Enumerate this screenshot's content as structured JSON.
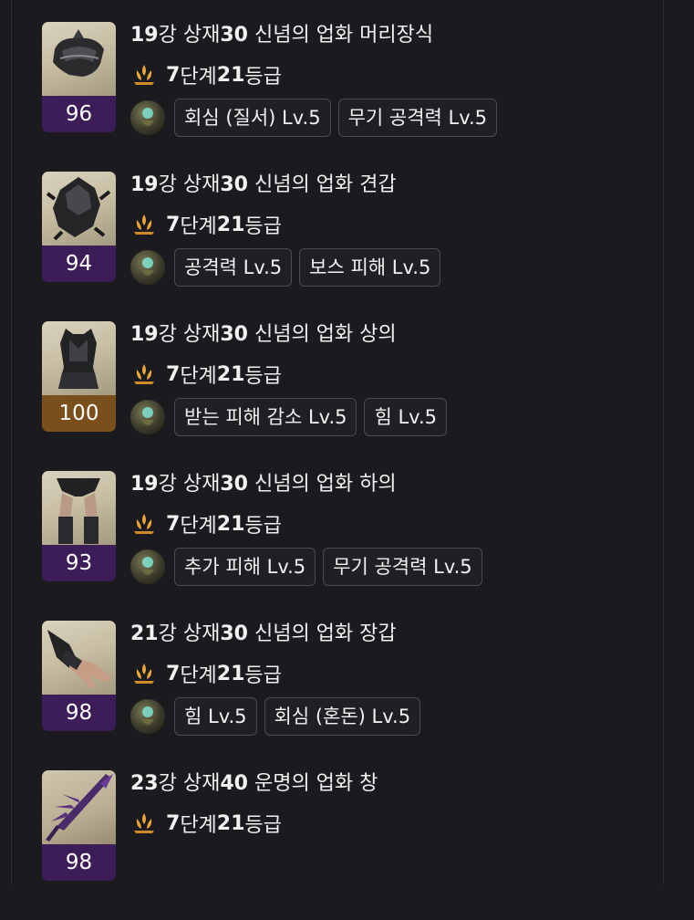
{
  "items": [
    {
      "level": "96",
      "title_num1": "19",
      "title_txt1": "강 상재",
      "title_num2": "30",
      "title_txt2": " 신념의 업화 머리장식",
      "tier_num1": "7",
      "tier_txt1": "단계 ",
      "tier_num2": "21",
      "tier_txt2": "등급",
      "engravings": [
        "회심 (질서) Lv.5",
        "무기 공격력 Lv.5"
      ]
    },
    {
      "level": "94",
      "title_num1": "19",
      "title_txt1": "강 상재",
      "title_num2": "30",
      "title_txt2": " 신념의 업화 견갑",
      "tier_num1": "7",
      "tier_txt1": "단계 ",
      "tier_num2": "21",
      "tier_txt2": "등급",
      "engravings": [
        "공격력 Lv.5",
        "보스 피해 Lv.5"
      ]
    },
    {
      "level": "100",
      "title_num1": "19",
      "title_txt1": "강 상재",
      "title_num2": "30",
      "title_txt2": " 신념의 업화 상의",
      "tier_num1": "7",
      "tier_txt1": "단계 ",
      "tier_num2": "21",
      "tier_txt2": "등급",
      "engravings": [
        "받는 피해 감소 Lv.5",
        "힘 Lv.5"
      ]
    },
    {
      "level": "93",
      "title_num1": "19",
      "title_txt1": "강 상재",
      "title_num2": "30",
      "title_txt2": " 신념의 업화 하의",
      "tier_num1": "7",
      "tier_txt1": "단계 ",
      "tier_num2": "21",
      "tier_txt2": "등급",
      "engravings": [
        "추가 피해 Lv.5",
        "무기 공격력 Lv.5"
      ]
    },
    {
      "level": "98",
      "title_num1": "21",
      "title_txt1": "강 상재",
      "title_num2": "30",
      "title_txt2": " 신념의 업화 장갑",
      "tier_num1": "7",
      "tier_txt1": "단계 ",
      "tier_num2": "21",
      "tier_txt2": "등급",
      "engravings": [
        "힘 Lv.5",
        "회심 (혼돈) Lv.5"
      ]
    },
    {
      "level": "98",
      "title_num1": "23",
      "title_txt1": "강 상재",
      "title_num2": "40",
      "title_txt2": " 운명의 업화 창",
      "tier_num1": "7",
      "tier_txt1": "단계 ",
      "tier_num2": "21",
      "tier_txt2": "등급",
      "engravings": []
    }
  ],
  "colors": {
    "background": "#1b1b1f",
    "level_purple": "#3d1d58",
    "level_gold": "#7a4f1c",
    "flame": "#e8a53a"
  },
  "icons": {
    "tier": "flame-icon",
    "engraving": "elixir-orb-icon",
    "head": "helmet-icon",
    "shoulder": "pauldron-icon",
    "chest": "chest-armor-icon",
    "legs": "leg-armor-icon",
    "gloves": "glove-icon",
    "weapon": "spear-icon"
  }
}
